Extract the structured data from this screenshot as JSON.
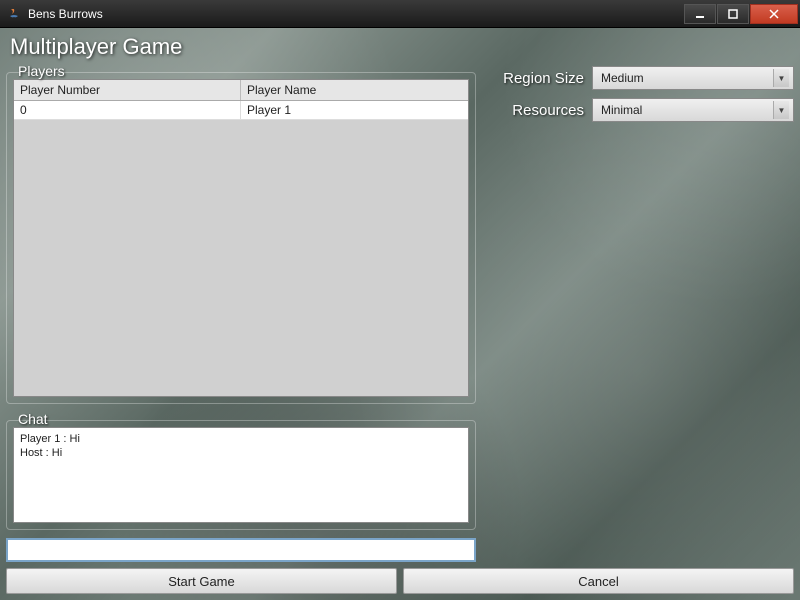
{
  "window": {
    "title": "Bens Burrows"
  },
  "page_title": "Multiplayer Game",
  "players_panel": {
    "title": "Players",
    "columns": {
      "number": "Player Number",
      "name": "Player Name"
    },
    "rows": [
      {
        "number": "0",
        "name": "Player 1"
      }
    ]
  },
  "chat_panel": {
    "title": "Chat",
    "messages": [
      "Player 1 : Hi",
      "Host : Hi"
    ],
    "input_value": ""
  },
  "settings": {
    "region_size": {
      "label": "Region Size",
      "value": "Medium"
    },
    "resources": {
      "label": "Resources",
      "value": "Minimal"
    }
  },
  "buttons": {
    "start": "Start Game",
    "cancel": "Cancel"
  }
}
